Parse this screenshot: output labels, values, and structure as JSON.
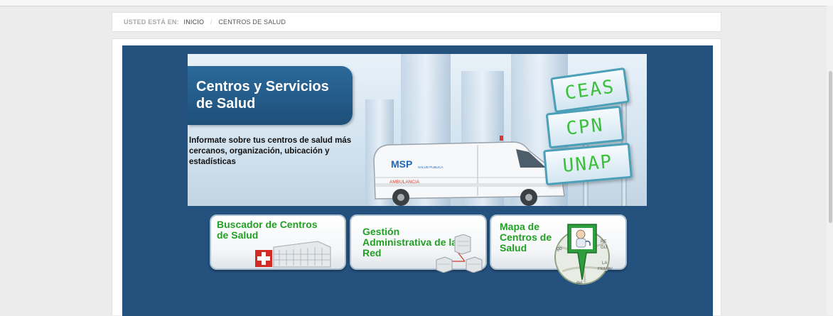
{
  "breadcrumb": {
    "prefix": "USTED ESTÁ EN:",
    "home": "INICIO",
    "separator": "/",
    "current": "CENTROS DE SALUD"
  },
  "banner": {
    "title": "Centros y Servicios de Salud",
    "subtitle": "Informate sobre tus centros de salud más cercanos, organización, ubicación y estadísticas",
    "signs": [
      "CEAS",
      "CPN",
      "UNAP"
    ],
    "ambulance": {
      "logo_text": "MSP",
      "logo_caption": "SALUD PUBLICA",
      "side_text": "AMBULANCIA"
    }
  },
  "buttons": [
    {
      "label": "Buscador de Centros de Salud"
    },
    {
      "label": "Gestión Administrativa de la Red"
    },
    {
      "label": "Mapa de Centros de Salud"
    }
  ],
  "map_fragments": [
    "RE",
    "GU",
    "LA",
    "PRIMAV",
    "go",
    "del"
  ],
  "colors": {
    "panel": "#24517e",
    "button_text": "#22a024",
    "sign_text": "#3cc03c"
  }
}
